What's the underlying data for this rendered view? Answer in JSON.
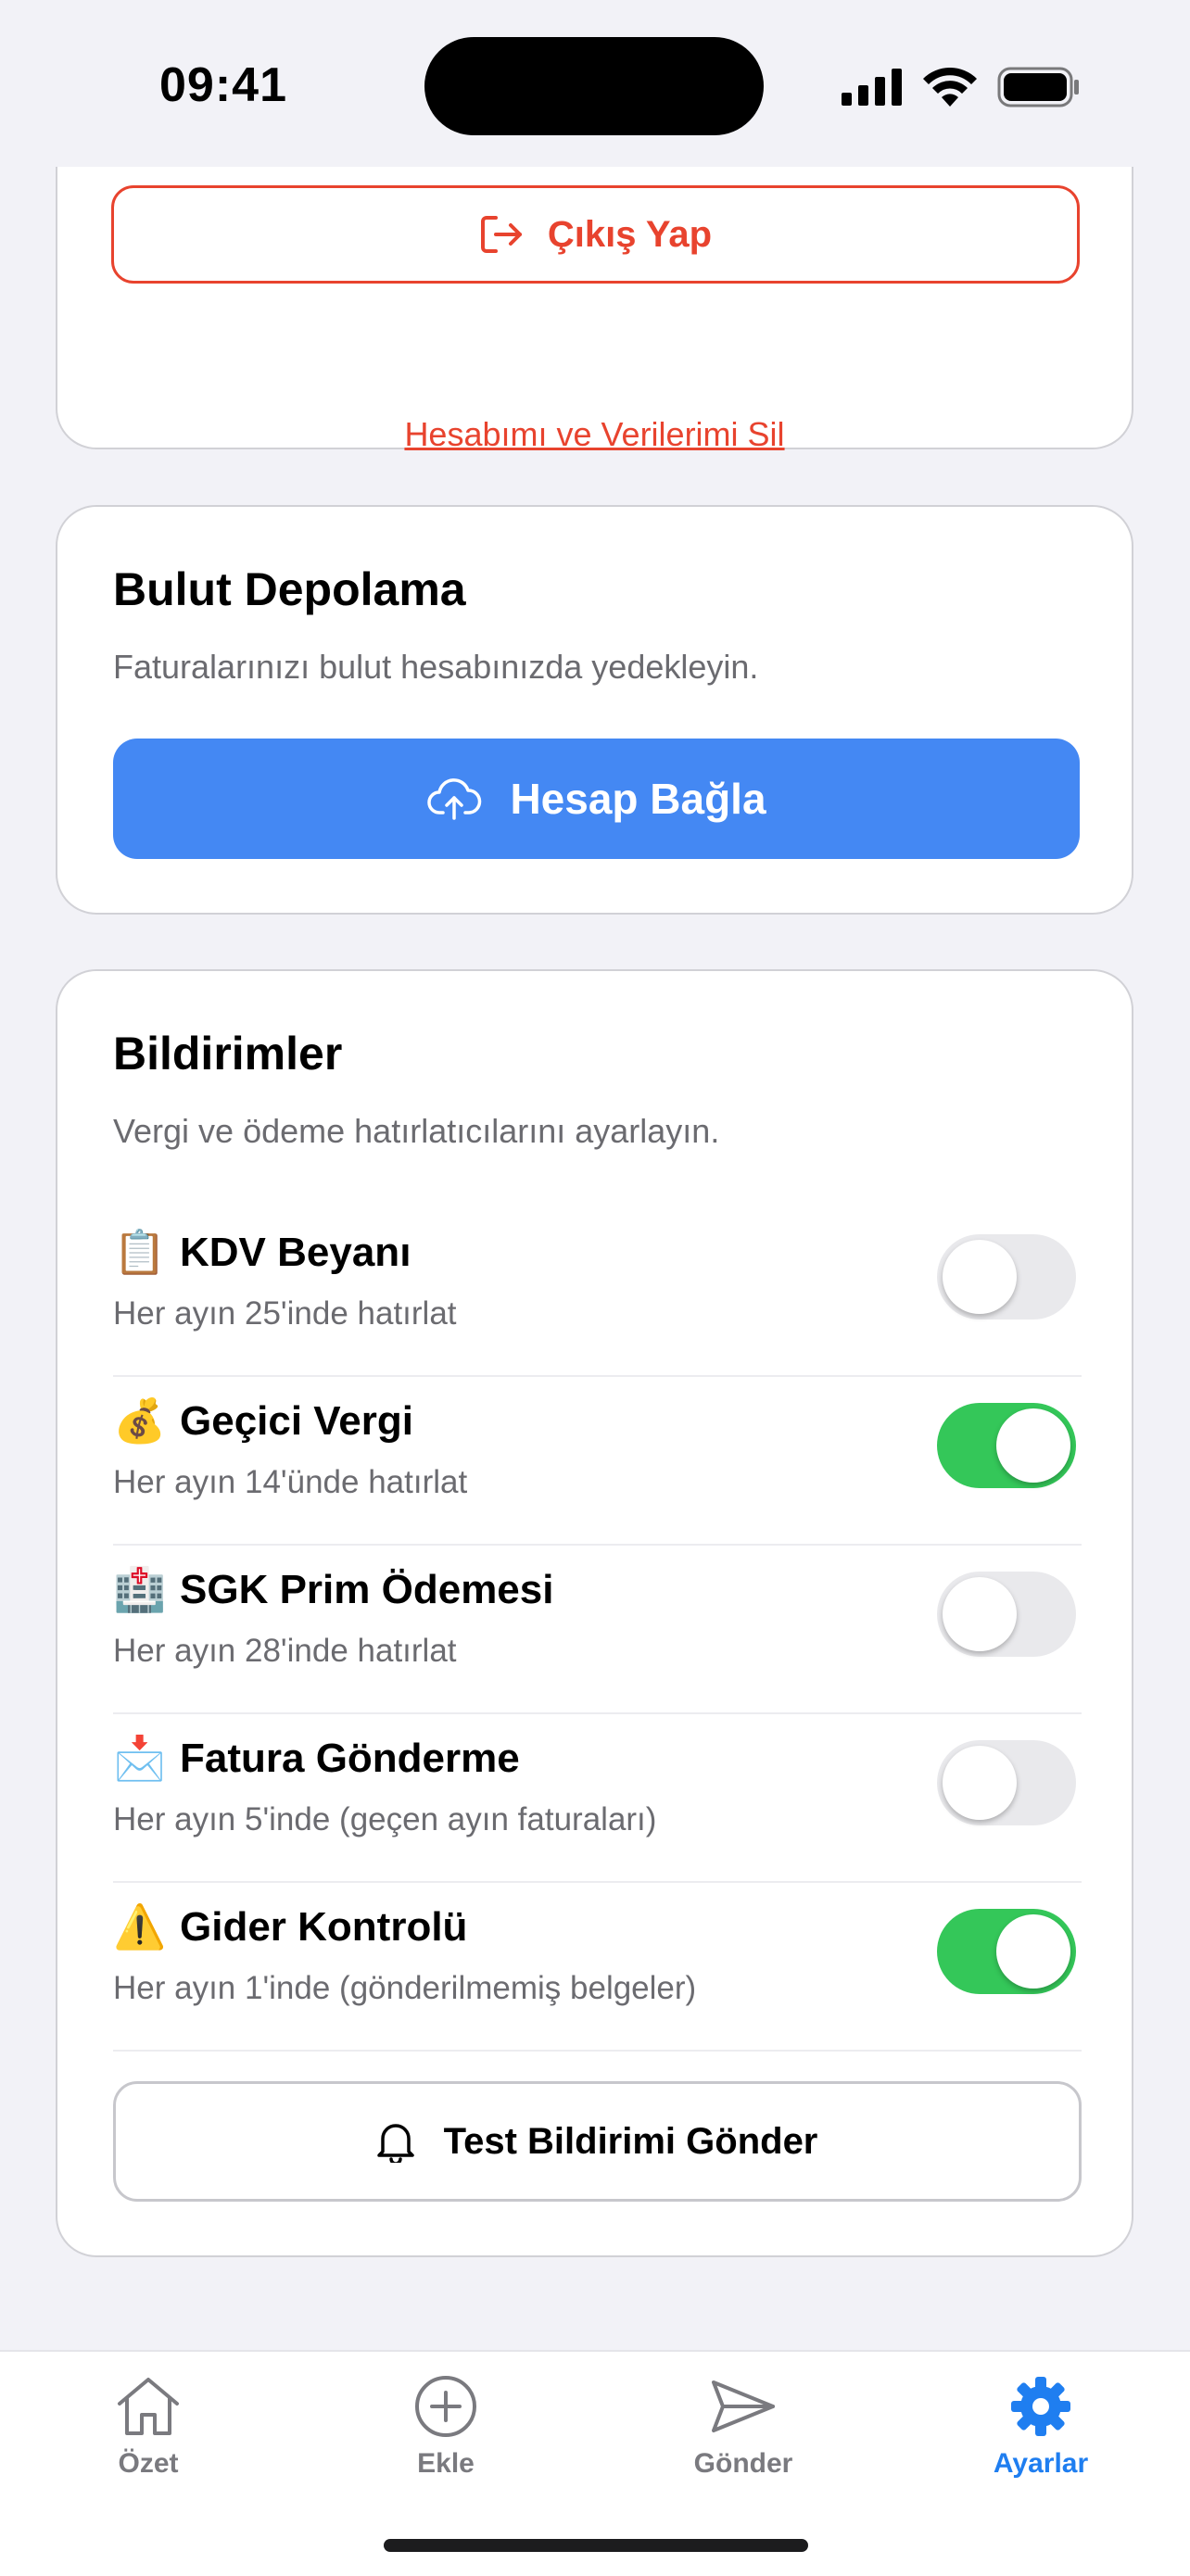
{
  "status_bar": {
    "time": "09:41"
  },
  "account": {
    "logout_label": "Çıkış Yap",
    "delete_label": "Hesabımı ve Verilerimi Sil"
  },
  "cloud": {
    "title": "Bulut Depolama",
    "subtitle": "Faturalarınızı bulut hesabınızda yedekleyin.",
    "button_label": "Hesap Bağla"
  },
  "notifications": {
    "title": "Bildirimler",
    "subtitle": "Vergi ve ödeme hatırlatıcılarını ayarlayın.",
    "items": [
      {
        "icon": "clipboard-icon",
        "emoji": "📋",
        "title": "KDV Beyanı",
        "desc": "Her ayın 25'inde hatırlat",
        "enabled": false
      },
      {
        "icon": "money-bag-icon",
        "emoji": "💰",
        "title": "Geçici Vergi",
        "desc": "Her ayın 14'ünde hatırlat",
        "enabled": true
      },
      {
        "icon": "hospital-icon",
        "emoji": "🏥",
        "title": "SGK Prim Ödemesi",
        "desc": "Her ayın 28'inde hatırlat",
        "enabled": false
      },
      {
        "icon": "envelope-icon",
        "emoji": "📩",
        "title": "Fatura Gönderme",
        "desc": "Her ayın 5'inde (geçen ayın faturaları)",
        "enabled": false
      },
      {
        "icon": "warning-icon",
        "emoji": "⚠️",
        "title": "Gider Kontrolü",
        "desc": "Her ayın 1'inde (gönderilmemiş belgeler)",
        "enabled": true
      }
    ],
    "test_button_label": "Test Bildirimi Gönder"
  },
  "tabbar": {
    "items": [
      {
        "label": "Özet",
        "icon": "home-icon",
        "active": false
      },
      {
        "label": "Ekle",
        "icon": "plus-circle-icon",
        "active": false
      },
      {
        "label": "Gönder",
        "icon": "send-icon",
        "active": false
      },
      {
        "label": "Ayarlar",
        "icon": "gear-icon",
        "active": true
      }
    ]
  },
  "colors": {
    "danger": "#e8432e",
    "primary": "#4488f3",
    "toggle_on": "#34c759",
    "tab_active": "#1f7ef0"
  }
}
